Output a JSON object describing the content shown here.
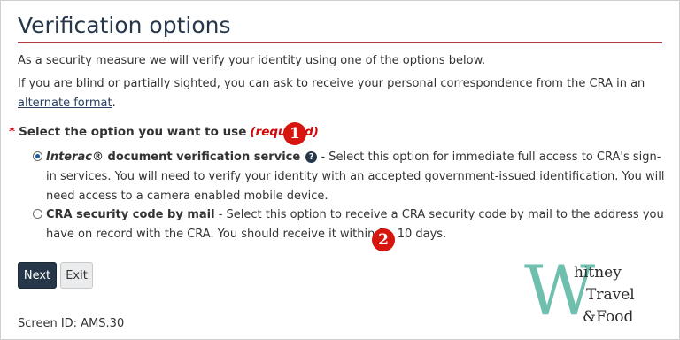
{
  "page": {
    "title": "Verification options",
    "intro": "As a security measure we will verify your identity using one of the options below.",
    "blind_text": "If you are blind or partially sighted, you can ask to receive your personal correspondence from the CRA in an ",
    "blind_link": "alternate format",
    "blind_end": "."
  },
  "question": {
    "required_star": "*",
    "label": "Select the option you want to use",
    "required_text": "(required)"
  },
  "annotations": {
    "badge1": "1",
    "badge2": "2"
  },
  "options": [
    {
      "selected": true,
      "brand": "Interac",
      "reg": "®",
      "title_rest": " document verification service",
      "help_glyph": "?",
      "description": " - Select this option for immediate full access to CRA's sign-in services. You will need to verify your identity with an accepted government-issued identification. You will need access to a camera enabled mobile device."
    },
    {
      "selected": false,
      "title": "CRA security code by mail",
      "description": " - Select this option to receive a CRA security code by mail to the address you have on record with the CRA. You should receive it within 5 - 10 days."
    }
  ],
  "buttons": {
    "next": "Next",
    "exit": "Exit"
  },
  "footer": {
    "screen_id": "Screen ID: AMS.30"
  },
  "watermark": {
    "letter": "W",
    "line1": "hitney",
    "line2": "Travel",
    "line3": "&Food"
  },
  "colors": {
    "title": "#26374a",
    "rule": "#af3c43",
    "required": "#d3080c",
    "badge": "#d6150f",
    "primary_button": "#26374a",
    "logo_w": "#6fbfae"
  }
}
